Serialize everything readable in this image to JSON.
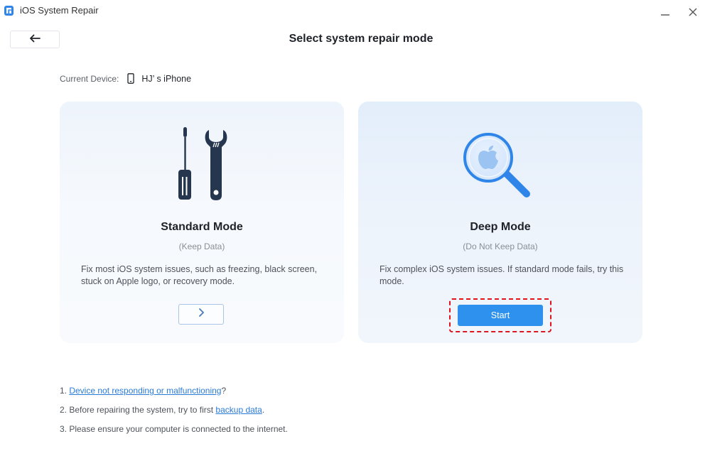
{
  "window": {
    "title": "iOS System Repair",
    "controls": [
      "minimize-icon",
      "close-icon"
    ]
  },
  "header": {
    "back_icon": "arrow-left-icon",
    "title": "Select system repair mode"
  },
  "device": {
    "label": "Current Device:",
    "icon": "phone-icon",
    "name": "HJ’ s iPhone"
  },
  "modes": {
    "standard": {
      "icon": "tools-icon",
      "title": "Standard Mode",
      "subtitle": "(Keep Data)",
      "description": "Fix most iOS system issues, such as freezing, black screen, stuck on Apple logo, or recovery mode.",
      "action_icon": "chevron-right-icon"
    },
    "deep": {
      "icon": "magnifier-apple-icon",
      "title": "Deep Mode",
      "subtitle": "(Do Not Keep Data)",
      "description": "Fix complex iOS system issues. If standard mode fails, try this mode.",
      "action_label": "Start"
    }
  },
  "notes": {
    "n1": {
      "prefix": "1. ",
      "link": "Device not responding or malfunctioning",
      "suffix": "?"
    },
    "n2": {
      "prefix": "2. Before repairing the system, try to first ",
      "link": "backup data",
      "suffix": "."
    },
    "n3": {
      "text": "3. Please ensure your computer is connected to the internet."
    }
  },
  "colors": {
    "accent": "#2e91ee",
    "highlight": "#e0141e",
    "link": "#2a7bd6",
    "icon_dark": "#26364f"
  }
}
